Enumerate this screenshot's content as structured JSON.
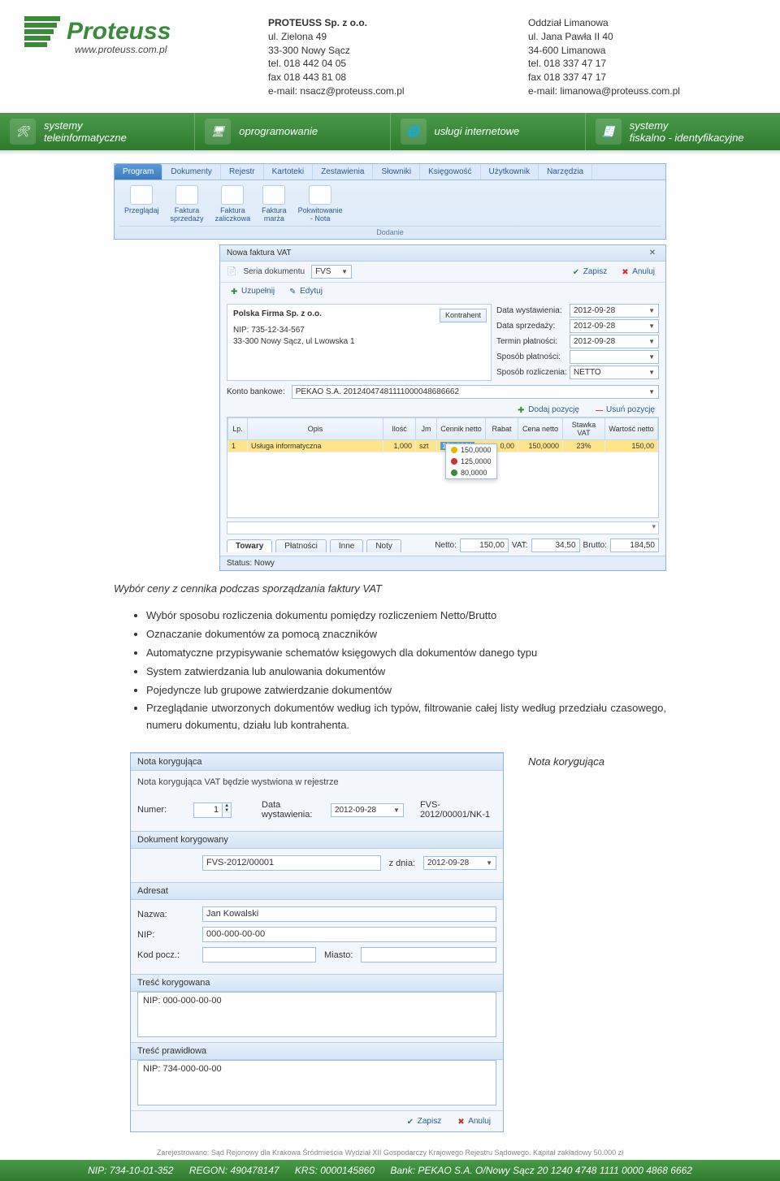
{
  "header": {
    "logo_name": "Proteuss",
    "logo_sub": "www.proteuss.com.pl",
    "col1": [
      "PROTEUSS Sp. z o.o.",
      "ul. Zielona 49",
      "33-300 Nowy Sącz",
      "tel. 018 442 04 05",
      "fax 018 443 81 08",
      "e-mail: nsacz@proteuss.com.pl"
    ],
    "col2": [
      "Oddział Limanowa",
      "ul. Jana Pawła II 40",
      "34-600 Limanowa",
      "tel. 018 337 47 17",
      "fax 018 337 47 17",
      "e-mail: limanowa@proteuss.com.pl"
    ]
  },
  "nav": [
    {
      "l1": "systemy",
      "l2": "teleinformatyczne"
    },
    {
      "l1": "oprogramowanie",
      "l2": ""
    },
    {
      "l1": "usługi internetowe",
      "l2": ""
    },
    {
      "l1": "systemy",
      "l2": "fiskalno - identyfikacyjne"
    }
  ],
  "ribbon": {
    "tabs": [
      "Program",
      "Dokumenty",
      "Rejestr",
      "Kartoteki",
      "Zestawienia",
      "Słowniki",
      "Księgowość",
      "Użytkownik",
      "Narzędzia"
    ],
    "buttons": [
      {
        "label": "Przeglądaj",
        "sub": ""
      },
      {
        "label": "Faktura",
        "sub": "sprzedaży"
      },
      {
        "label": "Faktura",
        "sub": "zaliczkowa"
      },
      {
        "label": "Faktura",
        "sub": "marża"
      },
      {
        "label": "Pokwitowanie",
        "sub": "- Nota"
      }
    ],
    "group": "Dodanie"
  },
  "invoice": {
    "win_title": "Nowa faktura VAT",
    "series_lbl": "Seria dokumentu",
    "series_val": "FVS",
    "uzupelnij": "Uzupełnij",
    "edytuj": "Edytuj",
    "kontrahent": "Kontrahent",
    "party_name": "Polska Firma Sp. z o.o.",
    "party_nip": "NIP: 735-12-34-567",
    "party_addr": "33-300 Nowy Sącz, ul Lwowska 1",
    "dates": {
      "wyst_lbl": "Data wystawienia:",
      "wyst": "2012-09-28",
      "sprz_lbl": "Data sprzedaży:",
      "sprz": "2012-09-28",
      "term_lbl": "Termin płatności:",
      "term": "2012-09-28",
      "spos_lbl": "Sposób płatności:",
      "spos": "",
      "rozl_lbl": "Sposób rozliczenia:",
      "rozl": "NETTO"
    },
    "zapisz": "Zapisz",
    "anuluj": "Anuluj",
    "bank_lbl": "Konto bankowe:",
    "bank_val": "PEKAO S.A. 20124047481111000048686662",
    "add_pos": "Dodaj pozycję",
    "del_pos": "Usuń pozycję",
    "cols": [
      "Lp.",
      "Opis",
      "Ilość",
      "Jm",
      "Cennik netto",
      "Rabat",
      "Cena netto",
      "Stawka VAT",
      "Wartość netto"
    ],
    "row": {
      "lp": "1",
      "opis": "Usługa informatyczna",
      "ilosc": "1,000",
      "jm": "szt",
      "cennik": "150,0000",
      "rabat": "0,00",
      "cena": "150,0000",
      "vat": "23%",
      "wart": "150,00"
    },
    "prices": [
      "150,0000",
      "125,0000",
      "80,0000"
    ],
    "tabs": [
      "Towary",
      "Płatności",
      "Inne",
      "Noty"
    ],
    "totals": {
      "netto_lbl": "Netto:",
      "netto": "150,00",
      "vat_lbl": "VAT:",
      "vat": "34,50",
      "brutto_lbl": "Brutto:",
      "brutto": "184,50"
    },
    "status": "Status: Nowy"
  },
  "caption": "Wybór ceny z cennika podczas sporządzania faktury VAT",
  "bullets": [
    "Wybór sposobu rozliczenia dokumentu pomiędzy rozliczeniem Netto/Brutto",
    "Oznaczanie dokumentów za pomocą znaczników",
    "Automatyczne przypisywanie schematów księgowych dla dokumentów danego typu",
    "System zatwierdzania lub anulowania dokumentów",
    "Pojedyncze lub grupowe zatwierdzanie dokumentów",
    "Przeglądanie utworzonych dokumentów według ich typów, filtrowanie całej listy według przedziału czasowego, numeru dokumentu, działu lub kontrahenta."
  ],
  "dlg": {
    "title": "Nota korygująca",
    "note": "Nota korygująca VAT będzie wystwiona w rejestrze",
    "numer_lbl": "Numer:",
    "numer": "1",
    "data_lbl": "Data wystawienia:",
    "data": "2012-09-28",
    "docnum": "FVS-2012/00001/NK-1",
    "sec_kor": "Dokument korygowany",
    "kor_doc": "FVS-2012/00001",
    "kor_zdnia_lbl": "z dnia:",
    "kor_zdnia": "2012-09-28",
    "sec_adr": "Adresat",
    "nazwa_lbl": "Nazwa:",
    "nazwa": "Jan Kowalski",
    "nip_lbl": "NIP:",
    "nip": "000-000-00-00",
    "kod_lbl": "Kod pocz.:",
    "kod": "",
    "miasto_lbl": "Miasto:",
    "miasto": "",
    "sec_tk": "Treść korygowana",
    "tk": "NIP: 000-000-00-00",
    "sec_tp": "Treść prawidłowa",
    "tp": "NIP: 734-000-00-00",
    "zapisz": "Zapisz",
    "anuluj": "Anuluj"
  },
  "side": "Nota korygująca",
  "reg": "Zarejestrowano: Sąd Rejonowy dla Krakowa Śródmieścia Wydział XII Gospodarczy Krajowego Rejestru Sądowego. Kapitał zakładowy 50.000 zł",
  "footer": {
    "nip": "NIP: 734-10-01-352",
    "regon": "REGON: 490478147",
    "krs": "KRS: 0000145860",
    "bank": "Bank: PEKAO S.A. O/Nowy Sącz  20 1240 4748 1111 0000 4868 6662"
  }
}
